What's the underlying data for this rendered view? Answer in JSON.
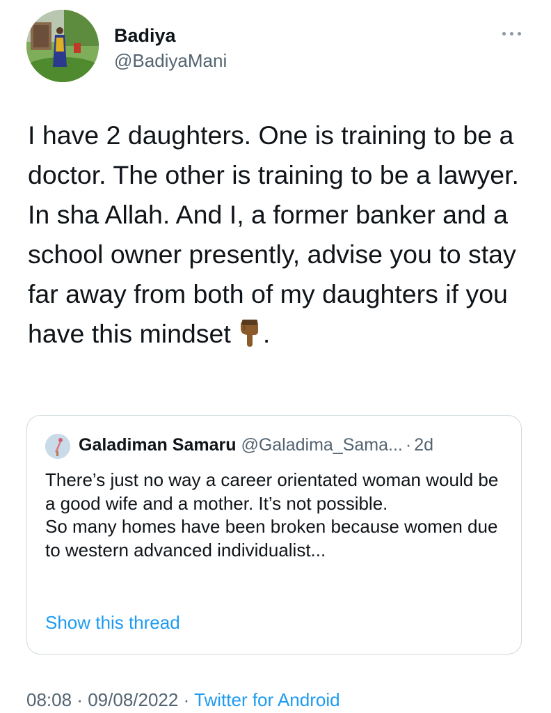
{
  "author": {
    "display_name": "Badiya",
    "handle": "@BadiyaMani"
  },
  "more_icon": "more-horizontal-icon",
  "tweet": {
    "text": "I have 2 daughters. One is training to be a doctor. The other is training to be a lawyer. In sha Allah. And I, a former banker and a school owner presently, advise you to stay far away from both of my daughters if you have this mindset",
    "emoji": "backhand-index-pointing-down-icon",
    "trailing": "."
  },
  "quoted_tweet": {
    "display_name": "Galadiman Samaru",
    "handle": "@Galadima_Sama...",
    "separator": "·",
    "time": "2d",
    "text": "There’s just no way a career orientated woman would be a good wife and a mother. It’s not possible.\nSo many homes have been broken because women due to western advanced individualist...",
    "show_thread_label": "Show this thread"
  },
  "meta": {
    "time": "08:08",
    "date": "09/08/2022",
    "separator": "·",
    "source": "Twitter for Android"
  },
  "colors": {
    "text": "#0f1419",
    "secondary": "#536471",
    "link": "#1d9bf0",
    "border": "#cfd9de"
  }
}
